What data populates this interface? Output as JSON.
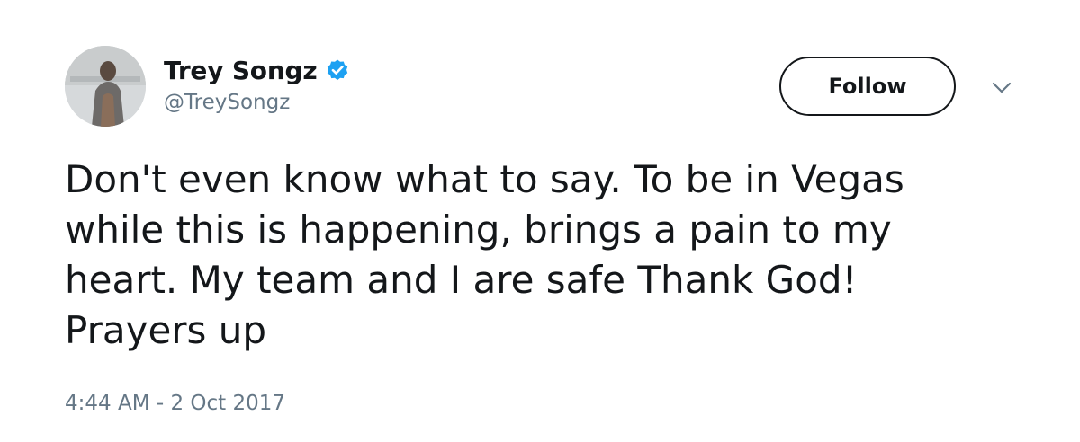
{
  "user": {
    "display_name": "Trey Songz",
    "handle": "@TreySongz",
    "verified": true,
    "avatar_icon": "profile-photo"
  },
  "follow_button": {
    "label": "Follow"
  },
  "menu": {
    "icon": "chevron-down-icon"
  },
  "tweet": {
    "text": "Don't even know what to say. To be in Vegas\nwhile this is happening, brings a pain to my\nheart. My team and I are safe Thank God!\nPrayers up",
    "timestamp": "4:44 AM - 2 Oct 2017"
  },
  "colors": {
    "text_primary": "#14171a",
    "text_secondary": "#657786",
    "verified_blue": "#1da1f2",
    "background": "#ffffff"
  }
}
